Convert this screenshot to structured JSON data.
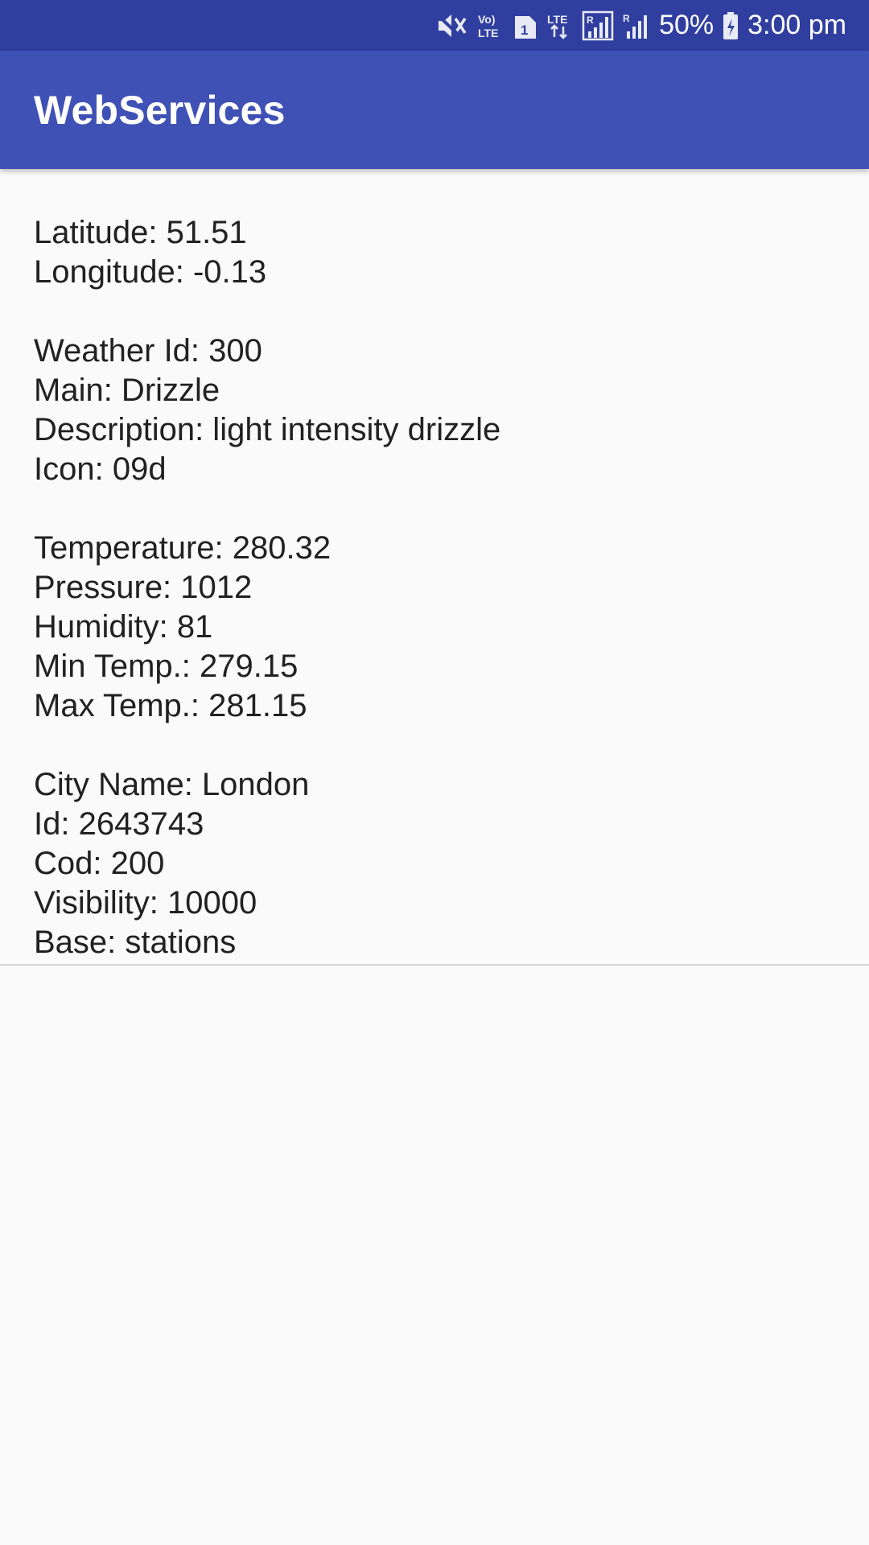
{
  "status_bar": {
    "battery_percent": "50%",
    "time": "3:00 pm",
    "icons": [
      "mute-icon",
      "volte-icon",
      "sim-1-icon",
      "lte-data-icon",
      "signal-r-icon",
      "signal-r2-icon",
      "battery-charging-icon"
    ],
    "volte_label": "Vo) LTE",
    "sim_label": "1"
  },
  "app_bar": {
    "title": "WebServices",
    "color": "#3f51b5",
    "status_color": "#303f9f"
  },
  "weather": {
    "coord": [
      "Latitude: 51.51",
      "Longitude: -0.13"
    ],
    "weather": [
      "Weather Id: 300",
      "Main: Drizzle",
      "Description: light intensity drizzle",
      "Icon: 09d"
    ],
    "main": [
      "Temperature: 280.32",
      "Pressure: 1012",
      "Humidity: 81",
      "Min Temp.: 279.15",
      "Max Temp.: 281.15"
    ],
    "city": [
      "City Name: London",
      "Id: 2643743",
      "Cod: 200",
      "Visibility: 10000",
      "Base: stations"
    ]
  }
}
